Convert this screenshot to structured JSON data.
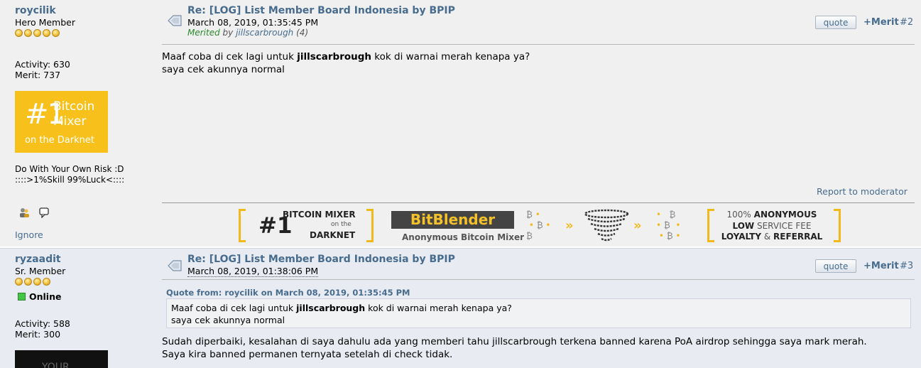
{
  "posts": [
    {
      "username": "roycilik",
      "rank": "Hero Member",
      "stars": 5,
      "activity": "Activity: 630",
      "merit_stat": "Merit: 737",
      "avatar": {
        "num": "#1",
        "line1": "Bitcoin",
        "line2": "Mixer",
        "line3": "on the Darknet"
      },
      "signature_line1": "Do With Your Own Risk :D",
      "signature_line2": "::::>1%Skill 99%Luck<::::",
      "ignore": "Ignore",
      "subject": "Re: [LOG] List Member Board Indonesia by BPIP",
      "date": "March 08, 2019, 01:35:45 PM",
      "merited_prefix": "Merited",
      "merited_by": "by",
      "merited_user": "jillscarbrough",
      "merited_count": "(4)",
      "quote_label": "quote",
      "merit_label": "+Merit",
      "post_number": "#2",
      "body_pre": "Maaf coba di cek lagi untuk ",
      "body_bold": "jillscarbrough",
      "body_post": " kok di warnai merah kenapa ya?",
      "body_line2": "saya cek akunnya normal",
      "report": "Report to moderator"
    },
    {
      "username": "ryzaadit",
      "rank": "Sr. Member",
      "stars": 4,
      "status": "Online",
      "activity": "Activity: 588",
      "merit_stat": "Merit: 300",
      "avatar_text": "YOUR",
      "subject": "Re: [LOG] List Member Board Indonesia by BPIP",
      "date": "March 08, 2019, 01:38:06 PM",
      "quote_label": "quote",
      "merit_label": "+Merit",
      "post_number": "#3",
      "quote_header": "Quote from: roycilik on March 08, 2019, 01:35:45 PM",
      "quote_pre": "Maaf coba di cek lagi untuk ",
      "quote_bold": "jillscarbrough",
      "quote_post": " kok di warnai merah kenapa ya?",
      "quote_line2": "saya cek akunnya normal",
      "body_line1": "Sudah diperbaiki, kesalahan di saya dahulu ada yang memberi tahu jillscarbrough terkena banned karena PoA airdrop sehingga saya mark merah.",
      "body_line2": "Saya kira banned permanen ternyata setelah di check tidak."
    }
  ],
  "banner": {
    "num": "#1",
    "l1": "BITCOIN MIXER",
    "l2": "on the",
    "l3": "DARKNET",
    "brand": "BitBlender",
    "brand_sub": "Anonymous Bitcoin Mixer",
    "r1a": "100% ",
    "r1b": "ANONYMOUS",
    "r2a": "LOW",
    "r2b": " SERVICE FEE",
    "r3a": "LOYALTY",
    "r3b": " & ",
    "r3c": "REFERRAL"
  }
}
